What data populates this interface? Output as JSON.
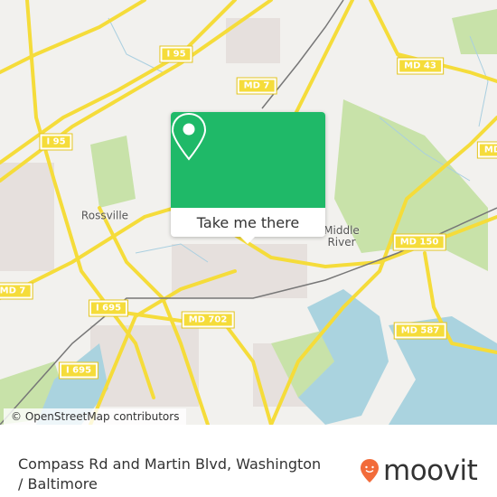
{
  "map": {
    "road_labels": [
      "I 95",
      "MD 7",
      "MD 43",
      "I 95",
      "MD",
      "MD 150",
      "MD 7",
      "I 695",
      "MD 702",
      "MD 587",
      "I 695"
    ],
    "places": [
      "Rossville",
      "Middle\nRiver"
    ],
    "colors": {
      "land": "#f2f1ee",
      "water": "#aad3df",
      "park": "#c8e2a9",
      "road": "#f5dc3a"
    }
  },
  "popup": {
    "button_label": "Take me there",
    "icon": "map-pin-icon",
    "color": "#1fb968"
  },
  "attribution": "© OpenStreetMap contributors",
  "footer": {
    "title": "Compass Rd and Martin Blvd, Washington / Baltimore",
    "brand": "moovit",
    "brand_color": "#f26b3a"
  }
}
